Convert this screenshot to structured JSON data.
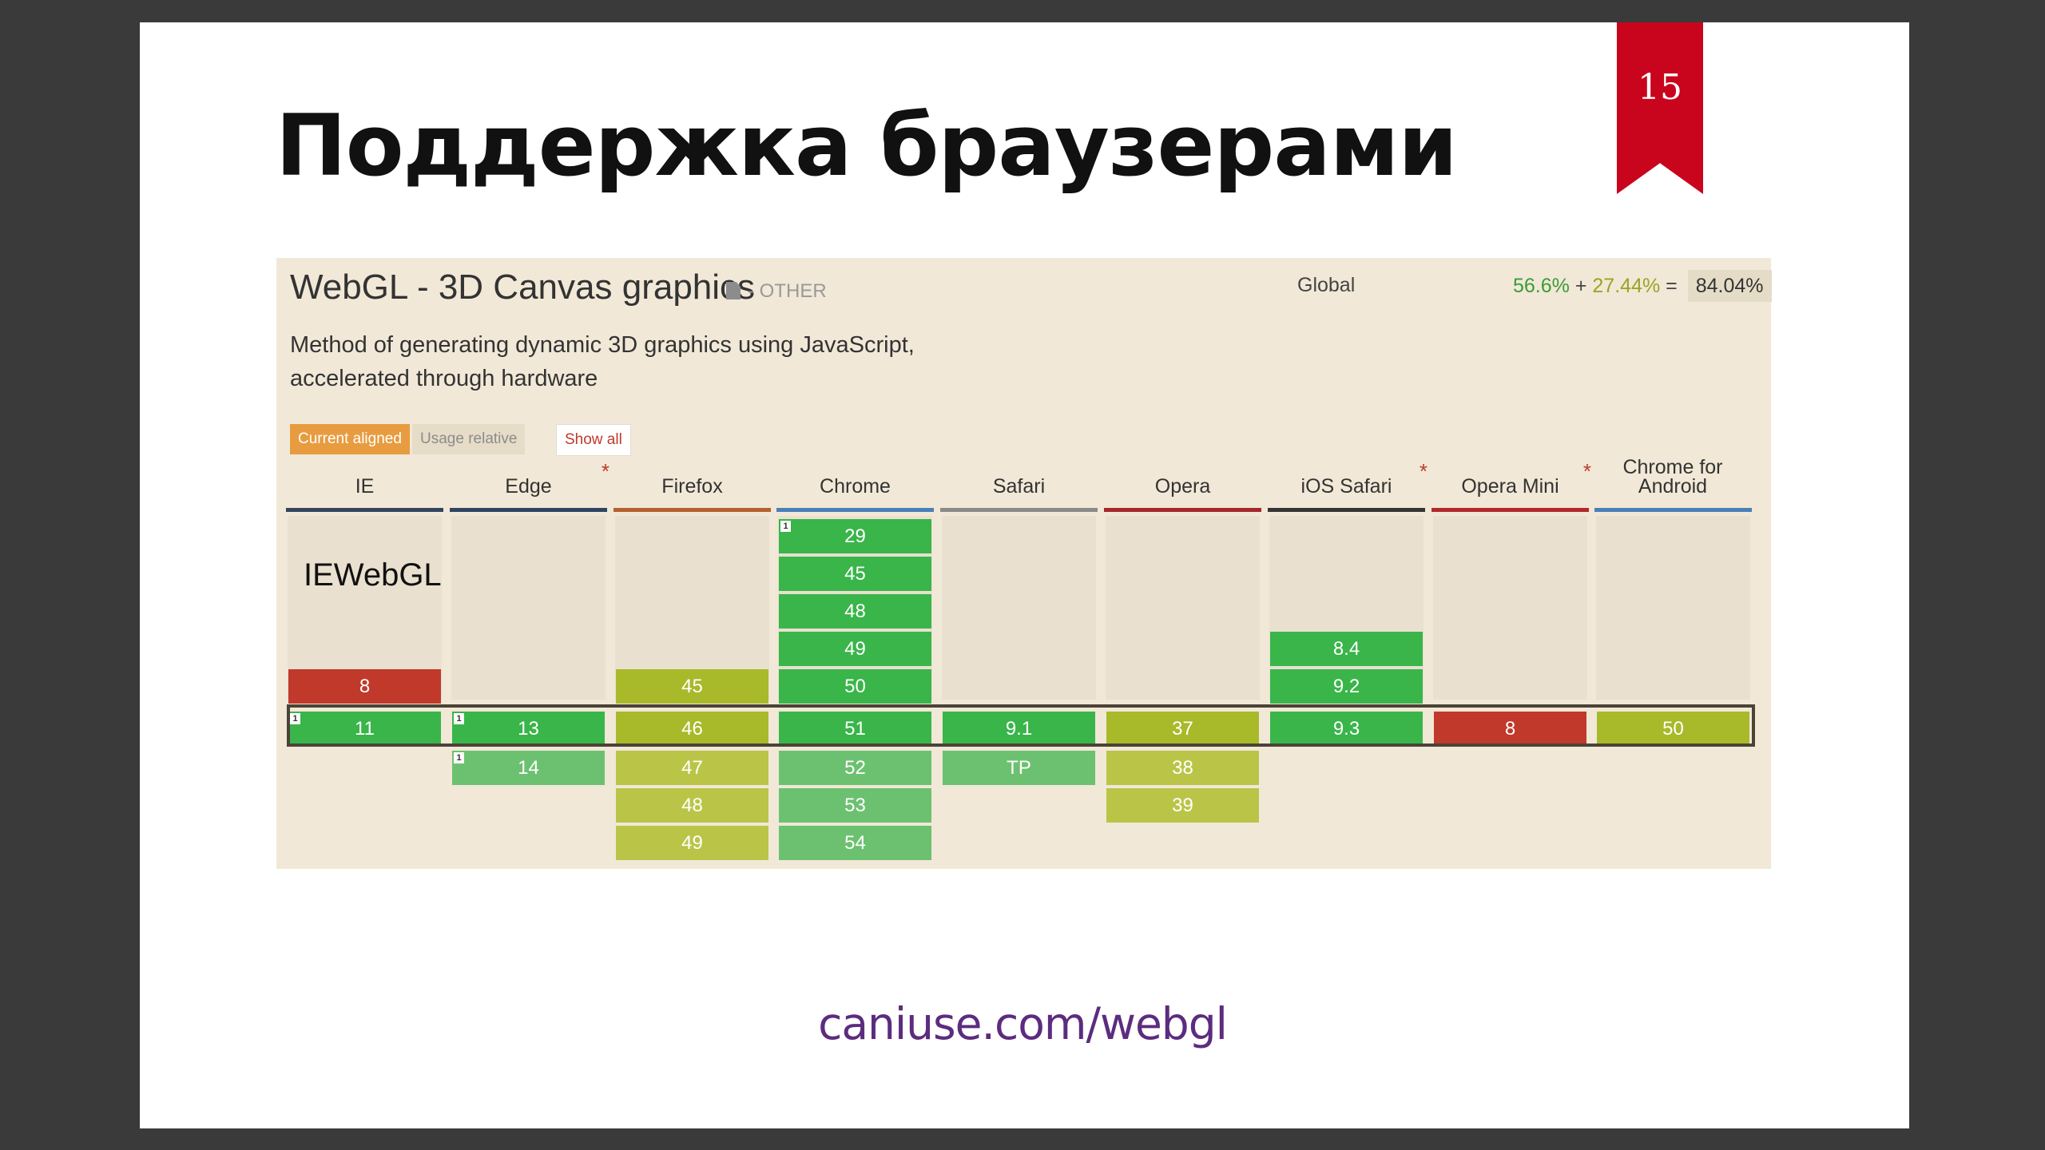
{
  "slide": {
    "number": "15",
    "title": "Поддержка браузерами",
    "link": "caniuse.com/webgl"
  },
  "feature": {
    "title": "WebGL - 3D Canvas graphics",
    "category": "- OTHER",
    "description_line1": "Method of generating dynamic 3D graphics using JavaScript,",
    "description_line2": "accelerated through hardware",
    "global_label": "Global",
    "usage_supported": "56.6%",
    "usage_plus": "+",
    "usage_partial": "27.44%",
    "usage_equals": "=",
    "usage_total": "84.04%",
    "btn_current": "Current aligned",
    "btn_relative": "Usage relative",
    "btn_show_all": "Show all"
  },
  "colors": {
    "supported": "#39b54a",
    "supported_future": "#6cc170",
    "partial": "#a8b92a",
    "partial_future": "#bac548",
    "unsupported": "#c0392b"
  },
  "browsers": [
    {
      "name": "IE",
      "star": false,
      "line_color": "#34445e",
      "overlay_text": "IEWebGL",
      "past": [
        "",
        "",
        "",
        "",
        "8"
      ],
      "past_status": [
        "",
        "",
        "",
        "",
        "n"
      ],
      "current": "11",
      "current_status": "y",
      "current_note": "1",
      "future": [],
      "future_status": [],
      "future_note": []
    },
    {
      "name": "Edge",
      "star": true,
      "line_color": "#2e4462",
      "overlay_text": "",
      "past": [
        "",
        "",
        "",
        "",
        ""
      ],
      "past_status": [
        "",
        "",
        "",
        "",
        ""
      ],
      "current": "13",
      "current_status": "y",
      "current_note": "1",
      "future": [
        "14"
      ],
      "future_status": [
        "yf"
      ],
      "future_note": [
        "1"
      ]
    },
    {
      "name": "Firefox",
      "star": false,
      "line_color": "#b5602e",
      "overlay_text": "",
      "past": [
        "",
        "",
        "",
        "",
        "45"
      ],
      "past_status": [
        "",
        "",
        "",
        "",
        "a"
      ],
      "current": "46",
      "current_status": "a",
      "current_note": "",
      "future": [
        "47",
        "48",
        "49"
      ],
      "future_status": [
        "af",
        "af",
        "af"
      ],
      "future_note": [
        "",
        "",
        ""
      ]
    },
    {
      "name": "Chrome",
      "star": false,
      "line_color": "#4a80b9",
      "overlay_text": "",
      "past": [
        "29",
        "45",
        "48",
        "49",
        "50"
      ],
      "past_status": [
        "y",
        "y",
        "y",
        "y",
        "y"
      ],
      "past_note": [
        "1",
        "",
        "",
        "",
        ""
      ],
      "current": "51",
      "current_status": "y",
      "current_note": "",
      "future": [
        "52",
        "53",
        "54"
      ],
      "future_status": [
        "yf",
        "yf",
        "yf"
      ],
      "future_note": [
        "",
        "",
        ""
      ]
    },
    {
      "name": "Safari",
      "star": false,
      "line_color": "#8a8a8a",
      "overlay_text": "",
      "past": [
        "",
        "",
        "",
        "",
        ""
      ],
      "past_status": [
        "",
        "",
        "",
        "",
        ""
      ],
      "current": "9.1",
      "current_status": "y",
      "current_note": "",
      "future": [
        "TP"
      ],
      "future_status": [
        "yf"
      ],
      "future_note": [
        ""
      ]
    },
    {
      "name": "Opera",
      "star": false,
      "line_color": "#a3272b",
      "overlay_text": "",
      "past": [
        "",
        "",
        "",
        "",
        ""
      ],
      "past_status": [
        "",
        "",
        "",
        "",
        ""
      ],
      "current": "37",
      "current_status": "a",
      "current_note": "",
      "future": [
        "38",
        "39"
      ],
      "future_status": [
        "af",
        "af"
      ],
      "future_note": [
        "",
        ""
      ]
    },
    {
      "name": "iOS Safari",
      "star": true,
      "line_color": "#353535",
      "overlay_text": "",
      "past": [
        "",
        "",
        "",
        "8.4",
        "9.2"
      ],
      "past_status": [
        "",
        "",
        "",
        "y",
        "y"
      ],
      "current": "9.3",
      "current_status": "y",
      "current_note": "",
      "future": [],
      "future_status": [],
      "future_note": []
    },
    {
      "name": "Opera Mini",
      "star": true,
      "line_color": "#b2282d",
      "overlay_text": "",
      "past": [
        "",
        "",
        "",
        "",
        ""
      ],
      "past_status": [
        "",
        "",
        "",
        "",
        ""
      ],
      "current": "8",
      "current_status": "n",
      "current_note": "",
      "future": [],
      "future_status": [],
      "future_note": []
    },
    {
      "name": "Chrome for Android",
      "star": false,
      "line_color": "#4a80b9",
      "overlay_text": "",
      "past": [
        "",
        "",
        "",
        "",
        ""
      ],
      "past_status": [
        "",
        "",
        "",
        "",
        ""
      ],
      "current": "50",
      "current_status": "a",
      "current_note": "",
      "future": [],
      "future_status": [],
      "future_note": []
    }
  ]
}
